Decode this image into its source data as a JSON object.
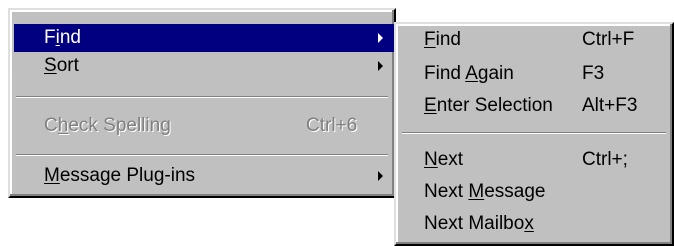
{
  "main_menu": {
    "items": [
      {
        "pre": "F",
        "acc": "i",
        "post": "nd",
        "shortcut": "",
        "submenu": true
      },
      {
        "pre": "",
        "acc": "S",
        "post": "ort",
        "shortcut": "",
        "submenu": true
      },
      {
        "pre": "C",
        "acc": "h",
        "post": "eck Spelling",
        "shortcut": "Ctrl+6",
        "submenu": false
      },
      {
        "pre": "",
        "acc": "M",
        "post": "essage Plug-ins",
        "shortcut": "",
        "submenu": true
      }
    ]
  },
  "sub_menu": {
    "items": [
      {
        "pre": "",
        "acc": "F",
        "post": "ind",
        "shortcut": "Ctrl+F"
      },
      {
        "pre": "Find ",
        "acc": "A",
        "post": "gain",
        "shortcut": "F3"
      },
      {
        "pre": "",
        "acc": "E",
        "post": "nter Selection",
        "shortcut": "Alt+F3"
      },
      {
        "pre": "",
        "acc": "N",
        "post": "ext",
        "shortcut": "Ctrl+;"
      },
      {
        "pre": "Next ",
        "acc": "M",
        "post": "essage",
        "shortcut": ""
      },
      {
        "pre": "Next Mailbo",
        "acc": "x",
        "post": "",
        "shortcut": ""
      }
    ]
  },
  "colors": {
    "menu_bg": "#c0c0c0",
    "highlight_bg": "#000080",
    "disabled_text": "#808080"
  }
}
